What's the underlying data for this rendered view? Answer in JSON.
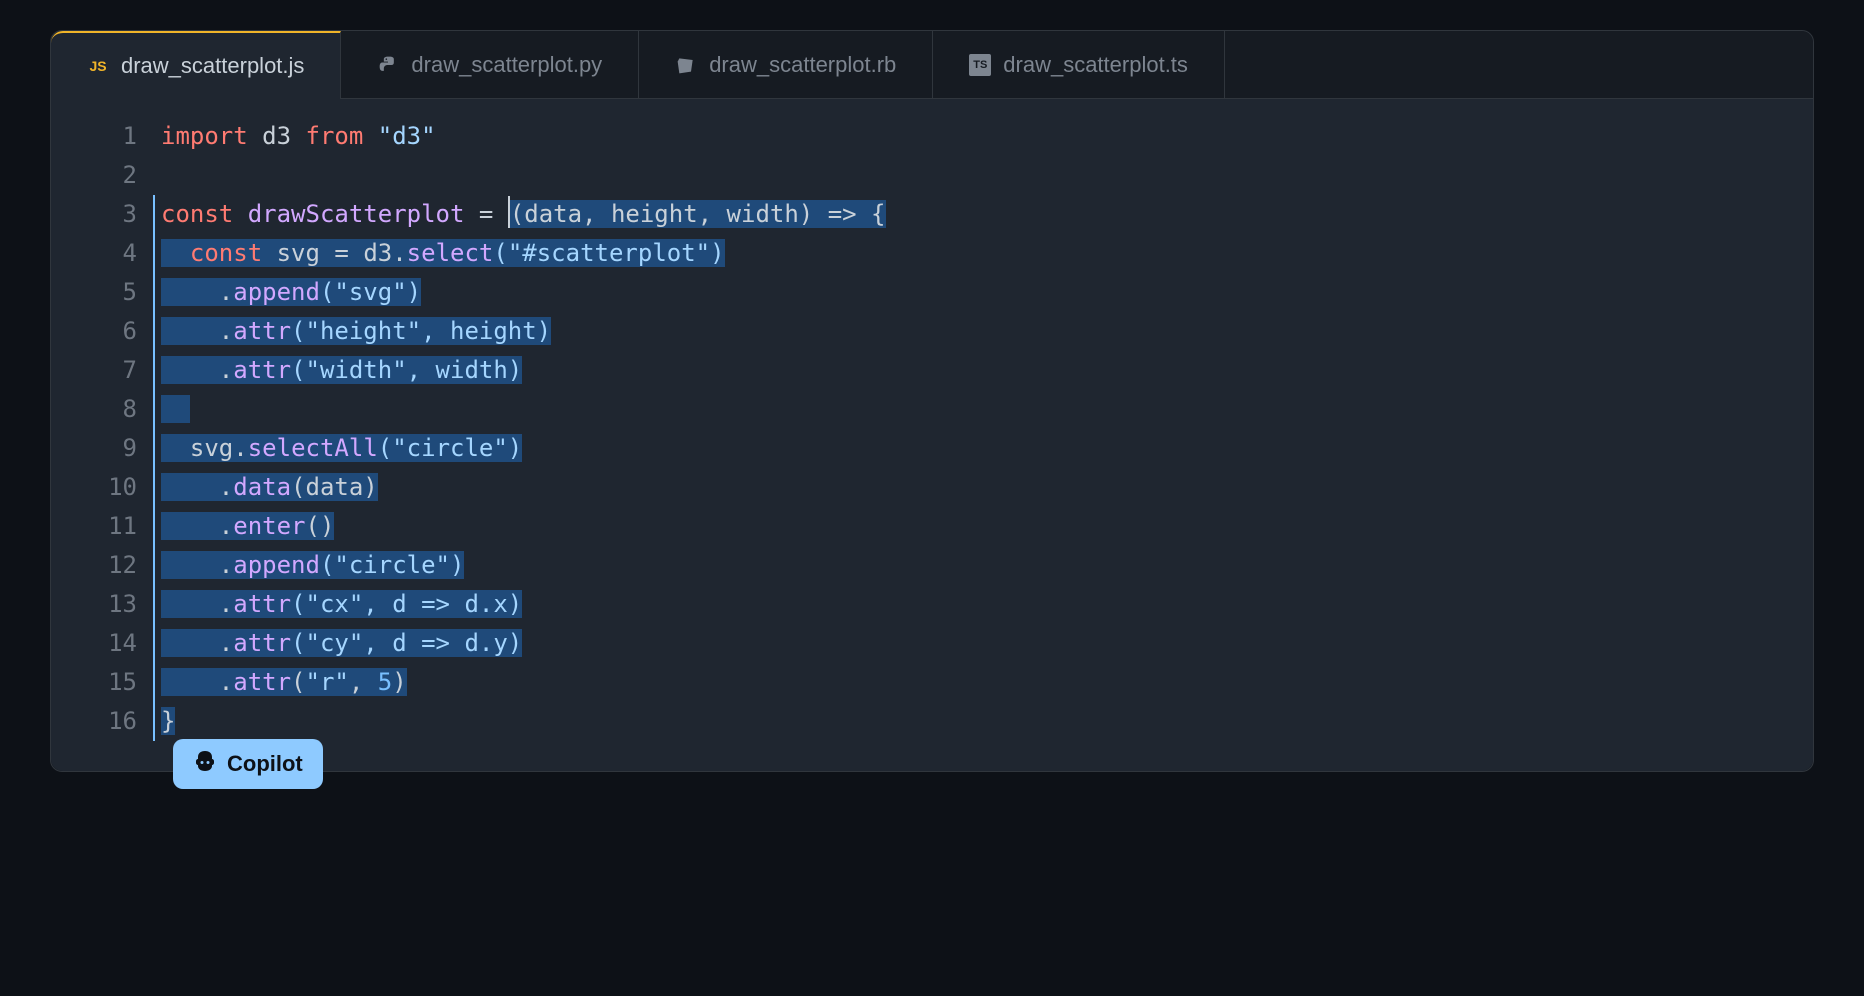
{
  "tabs": [
    {
      "label": "draw_scatterplot.js",
      "icon": "JS",
      "active": true
    },
    {
      "label": "draw_scatterplot.py",
      "icon": "py",
      "active": false
    },
    {
      "label": "draw_scatterplot.rb",
      "icon": "rb",
      "active": false
    },
    {
      "label": "draw_scatterplot.ts",
      "icon": "TS",
      "active": false
    }
  ],
  "code": {
    "line1": {
      "import": "import",
      "d3": "d3",
      "from": "from",
      "str": "\"d3\""
    },
    "line3": {
      "const": "const",
      "name": "drawScatterplot",
      "eq": " = ",
      "args": "(data, height, width)",
      "arrow": " => {"
    },
    "line4": {
      "pre": "  ",
      "const": "const",
      "svg": " svg ",
      "eq": "= ",
      "d3var": "d3",
      "dot": ".",
      "select": "select",
      "arg": "(\"#scatterplot\")"
    },
    "line5": {
      "pre": "    .",
      "method": "append",
      "arg": "(\"svg\")"
    },
    "line6": {
      "pre": "    .",
      "method": "attr",
      "arg": "(\"height\", height)"
    },
    "line7": {
      "pre": "    .",
      "method": "attr",
      "arg": "(\"width\", width)"
    },
    "line9": {
      "pre": "  ",
      "svg": "svg",
      "dot": ".",
      "method": "selectAll",
      "arg": "(\"circle\")"
    },
    "line10": {
      "pre": "    .",
      "method": "data",
      "arg": "(data)"
    },
    "line11": {
      "pre": "    .",
      "method": "enter",
      "arg": "()"
    },
    "line12": {
      "pre": "    .",
      "method": "append",
      "arg": "(\"circle\")"
    },
    "line13": {
      "pre": "    .",
      "method": "attr",
      "arg": "(\"cx\", d => d.x)"
    },
    "line14": {
      "pre": "    .",
      "method": "attr",
      "arg": "(\"cy\", d => d.y)"
    },
    "line15": {
      "pre": "    .",
      "method": "attr",
      "arg_open": "(",
      "str": "\"r\"",
      "comma": ", ",
      "num": "5",
      "close": ")"
    },
    "line16": {
      "brace": "}"
    }
  },
  "linenos": [
    "1",
    "2",
    "3",
    "4",
    "5",
    "6",
    "7",
    "8",
    "9",
    "10",
    "11",
    "12",
    "13",
    "14",
    "15",
    "16"
  ],
  "copilot": {
    "label": "Copilot"
  }
}
